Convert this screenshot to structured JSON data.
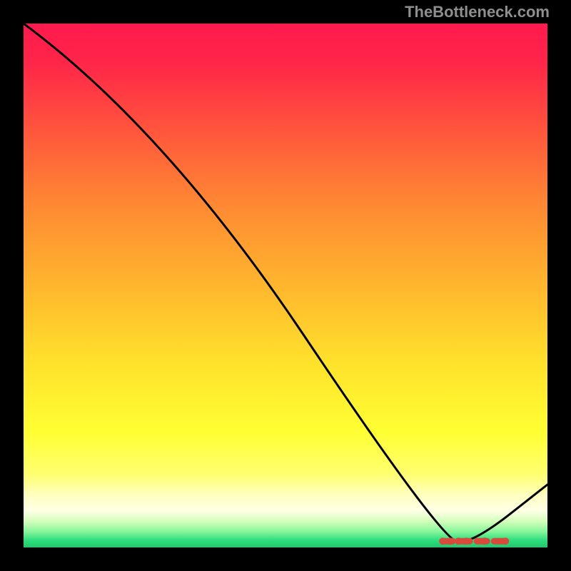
{
  "attribution": "TheBottleneck.com",
  "chart_data": {
    "type": "line",
    "title": "",
    "xlabel": "",
    "ylabel": "",
    "xlim": [
      0,
      100
    ],
    "ylim": [
      0,
      100
    ],
    "x": [
      0,
      27,
      80,
      86,
      100
    ],
    "values": [
      100,
      80,
      1,
      1,
      12
    ],
    "markers": {
      "x": [
        80,
        81.5,
        83,
        84.5,
        88,
        92
      ],
      "values": [
        1.2,
        1.2,
        1.2,
        1.2,
        1.2,
        1.2
      ]
    },
    "gradient_stops": [
      {
        "offset": 0.0,
        "color": "#ff1a4d"
      },
      {
        "offset": 0.07,
        "color": "#ff2449"
      },
      {
        "offset": 0.22,
        "color": "#ff5b3b"
      },
      {
        "offset": 0.35,
        "color": "#ff8a33"
      },
      {
        "offset": 0.5,
        "color": "#ffb62e"
      },
      {
        "offset": 0.65,
        "color": "#ffe22c"
      },
      {
        "offset": 0.78,
        "color": "#ffff33"
      },
      {
        "offset": 0.86,
        "color": "#ffff70"
      },
      {
        "offset": 0.9,
        "color": "#ffffc0"
      },
      {
        "offset": 0.93,
        "color": "#ffffe6"
      },
      {
        "offset": 0.95,
        "color": "#d3ffba"
      },
      {
        "offset": 0.97,
        "color": "#86f59a"
      },
      {
        "offset": 0.985,
        "color": "#33e07f"
      },
      {
        "offset": 1.0,
        "color": "#1cc96b"
      }
    ]
  }
}
